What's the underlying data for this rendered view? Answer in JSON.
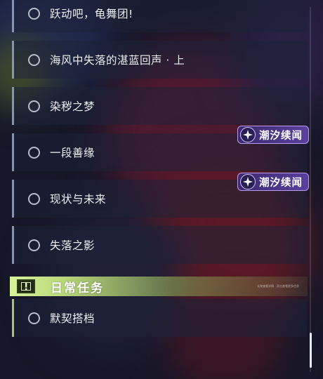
{
  "quests": [
    {
      "label": "跃动吧，龟舞团!"
    },
    {
      "label": "海风中失落的湛蓝回声 · 上"
    },
    {
      "label": "染秽之梦"
    },
    {
      "label": "一段善缘"
    },
    {
      "label": "现状与未来"
    },
    {
      "label": "失落之影"
    }
  ],
  "badges": [
    {
      "label": "潮汐续闻"
    },
    {
      "label": "潮汐续闻"
    }
  ],
  "daily_section": {
    "title": "日常任务",
    "icon": "alert-icon",
    "hint": "长按查看详情 · 双击查看更多信息"
  },
  "daily_quests": [
    {
      "label": "默契搭档"
    }
  ],
  "colors": {
    "quest_accent": "#7f97b5",
    "daily_accent": "#a9c27a",
    "badge_bg": "#4a3588",
    "section_bar": "#d8f29a"
  }
}
